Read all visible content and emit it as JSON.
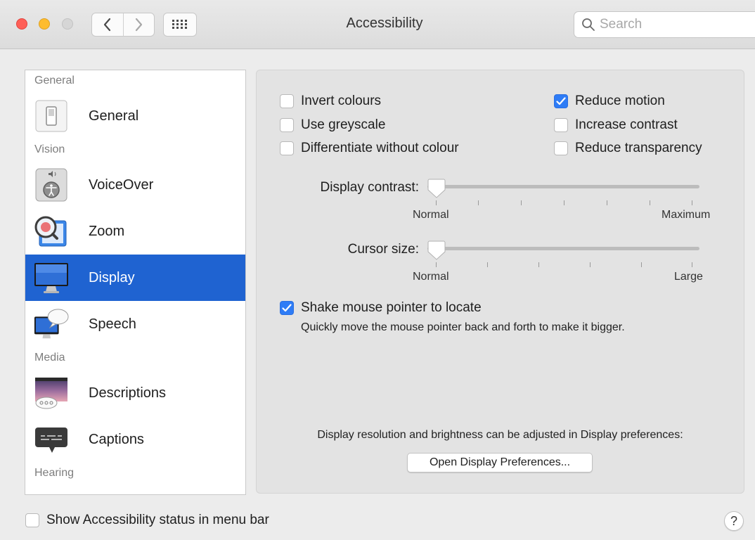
{
  "window": {
    "title": "Accessibility",
    "search_placeholder": "Search"
  },
  "sidebar": {
    "rows": [
      {
        "type": "section",
        "label": "General"
      },
      {
        "type": "item",
        "label": "General",
        "icon": "switch-icon"
      },
      {
        "type": "section",
        "label": "Vision"
      },
      {
        "type": "item",
        "label": "VoiceOver",
        "icon": "voiceover-icon"
      },
      {
        "type": "item",
        "label": "Zoom",
        "icon": "zoom-icon"
      },
      {
        "type": "item",
        "label": "Display",
        "icon": "display-icon",
        "selected": true
      },
      {
        "type": "item",
        "label": "Speech",
        "icon": "speech-icon"
      },
      {
        "type": "section",
        "label": "Media"
      },
      {
        "type": "item",
        "label": "Descriptions",
        "icon": "descriptions-icon"
      },
      {
        "type": "item",
        "label": "Captions",
        "icon": "captions-icon"
      },
      {
        "type": "section",
        "label": "Hearing"
      }
    ]
  },
  "options": {
    "invert_colours": {
      "label": "Invert colours",
      "checked": false
    },
    "use_greyscale": {
      "label": "Use greyscale",
      "checked": false
    },
    "differentiate": {
      "label": "Differentiate without colour",
      "checked": false
    },
    "reduce_motion": {
      "label": "Reduce motion",
      "checked": true
    },
    "increase_contrast": {
      "label": "Increase contrast",
      "checked": false
    },
    "reduce_transparency": {
      "label": "Reduce transparency",
      "checked": false
    }
  },
  "display_contrast": {
    "label": "Display contrast:",
    "min_label": "Normal",
    "max_label": "Maximum",
    "value": 0
  },
  "cursor_size": {
    "label": "Cursor size:",
    "min_label": "Normal",
    "max_label": "Large",
    "value": 0
  },
  "shake": {
    "label": "Shake mouse pointer to locate",
    "checked": true,
    "description": "Quickly move the mouse pointer back and forth to make it bigger."
  },
  "display_note": "Display resolution and brightness can be adjusted in Display preferences:",
  "open_button": "Open Display Preferences...",
  "footer": {
    "show_status": {
      "label": "Show Accessibility status in menu bar",
      "checked": false
    },
    "help": "?"
  },
  "colors": {
    "accent": "#2e7cf6",
    "selection": "#1f63d1"
  }
}
